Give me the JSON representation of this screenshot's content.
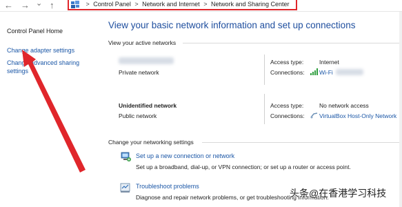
{
  "nav": {
    "back_glyph": "←",
    "forward_glyph": "→",
    "dropdown_glyph": "⌄",
    "up_glyph": "↑",
    "breadcrumb": [
      "Control Panel",
      "Network and Internet",
      "Network and Sharing Center"
    ],
    "separator": ">"
  },
  "sidebar": {
    "home": "Control Panel Home",
    "items": [
      {
        "label": "Change adapter settings"
      },
      {
        "label_line1": "Change advanced sharing",
        "label_line2": "settings"
      }
    ]
  },
  "main": {
    "title": "View your basic network information and set up connections",
    "active_networks_label": "View your active networks",
    "networks": [
      {
        "name": "",
        "type": "Private network",
        "access_type_label": "Access type:",
        "access_type": "Internet",
        "connections_label": "Connections:",
        "connection": "Wi-Fi"
      },
      {
        "name": "Unidentified network",
        "type": "Public network",
        "access_type_label": "Access type:",
        "access_type": "No network access",
        "connections_label": "Connections:",
        "connection": "VirtualBox Host-Only Network"
      }
    ],
    "settings_label": "Change your networking settings",
    "tasks": [
      {
        "icon": "new-connection-icon",
        "link": "Set up a new connection or network",
        "desc": "Set up a broadband, dial-up, or VPN connection; or set up a router or access point."
      },
      {
        "icon": "troubleshoot-icon",
        "link": "Troubleshoot problems",
        "desc": "Diagnose and repair network problems, or get troubleshooting information."
      }
    ]
  },
  "annotation": {
    "arrow_color": "#e0262b"
  },
  "watermark": "头条@在香港学习科技"
}
